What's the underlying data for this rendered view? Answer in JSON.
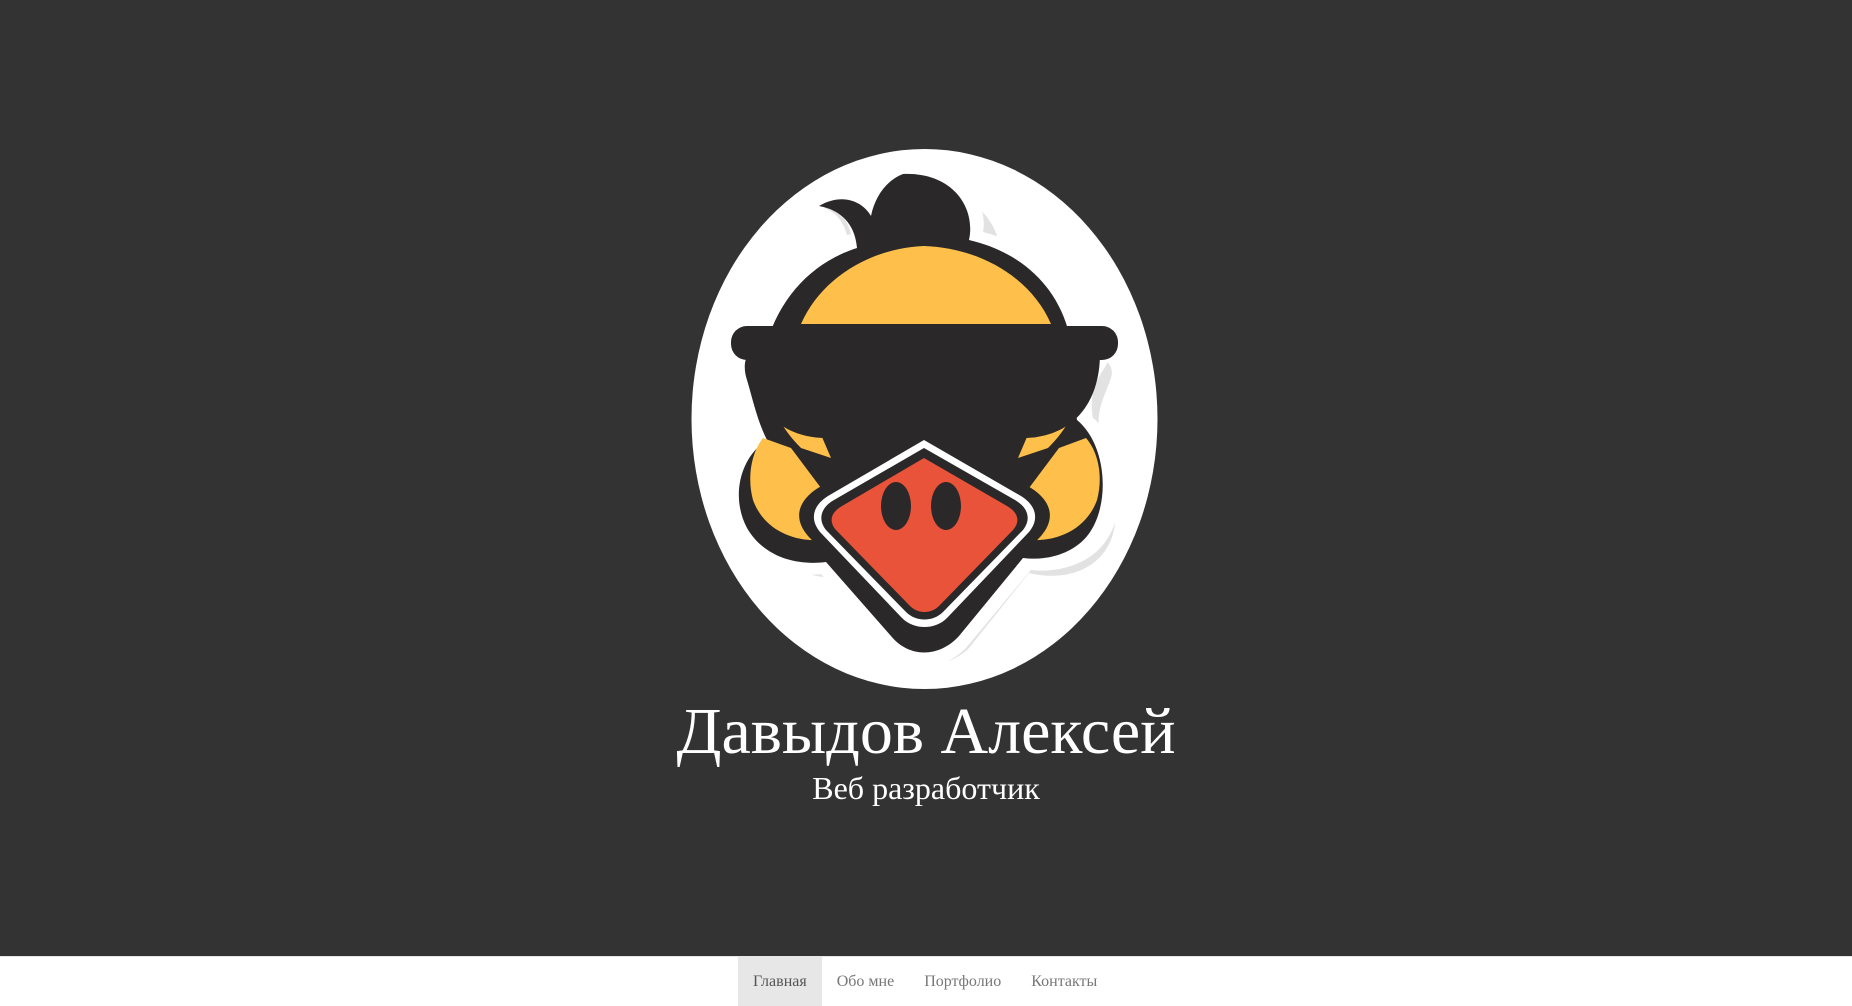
{
  "hero": {
    "name": "Давыдов Алексей",
    "role": "Веб разработчик",
    "avatar_icon": "duck-with-sunglasses-icon"
  },
  "nav": {
    "items": [
      {
        "label": "Главная",
        "active": true
      },
      {
        "label": "Обо мне",
        "active": false
      },
      {
        "label": "Портфолио",
        "active": false
      },
      {
        "label": "Контакты",
        "active": false
      }
    ]
  },
  "colors": {
    "hero_background": "#333333",
    "navbar_background": "#ffffff",
    "nav_active_background": "#e7e7e7",
    "nav_text": "#777777",
    "duck_yellow": "#fec04a",
    "duck_beak": "#e9533a",
    "outline": "#2a2828"
  }
}
